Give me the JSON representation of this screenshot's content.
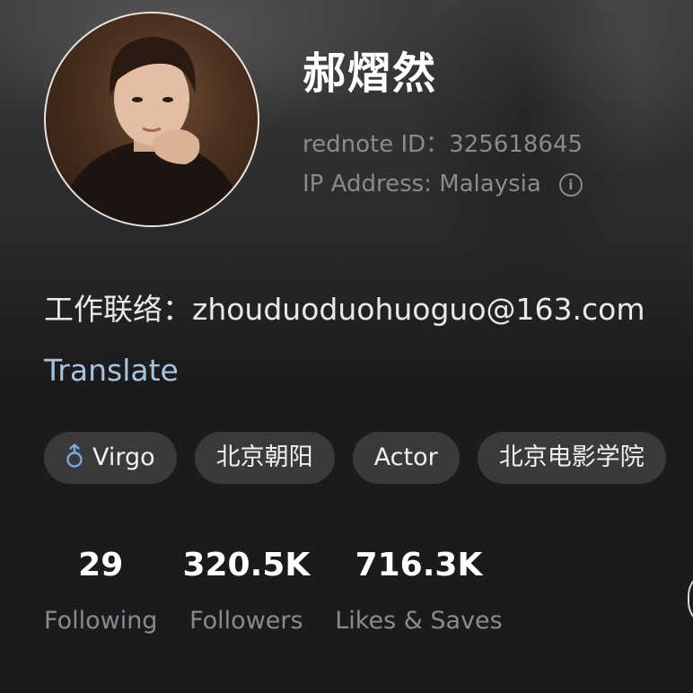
{
  "profile": {
    "name": "郝熠然",
    "id_label": "rednote ID：",
    "id_value": "325618645",
    "ip_label": "IP Address:",
    "ip_value": "Malaysia",
    "info_icon": "info-icon",
    "avatar_icon": "user-avatar"
  },
  "bio": {
    "text": "工作联络：zhouduoduohuoguo@163.com",
    "translate_label": "Translate"
  },
  "tags": [
    {
      "label": "Virgo",
      "icon": "male-symbol-icon",
      "icon_color": "#7ea6e0"
    },
    {
      "label": "北京朝阳"
    },
    {
      "label": "Actor"
    },
    {
      "label": "北京电影学院"
    }
  ],
  "stats": [
    {
      "value": "29",
      "label": "Following"
    },
    {
      "value": "320.5K",
      "label": "Followers"
    },
    {
      "value": "716.3K",
      "label": "Likes & Saves"
    }
  ],
  "colors": {
    "background": "#1b1b1d",
    "name": "#ffffff",
    "muted_text": "#8b8b8e",
    "translate_link": "#a8c3df",
    "tag_background": "#3a3a3d"
  }
}
